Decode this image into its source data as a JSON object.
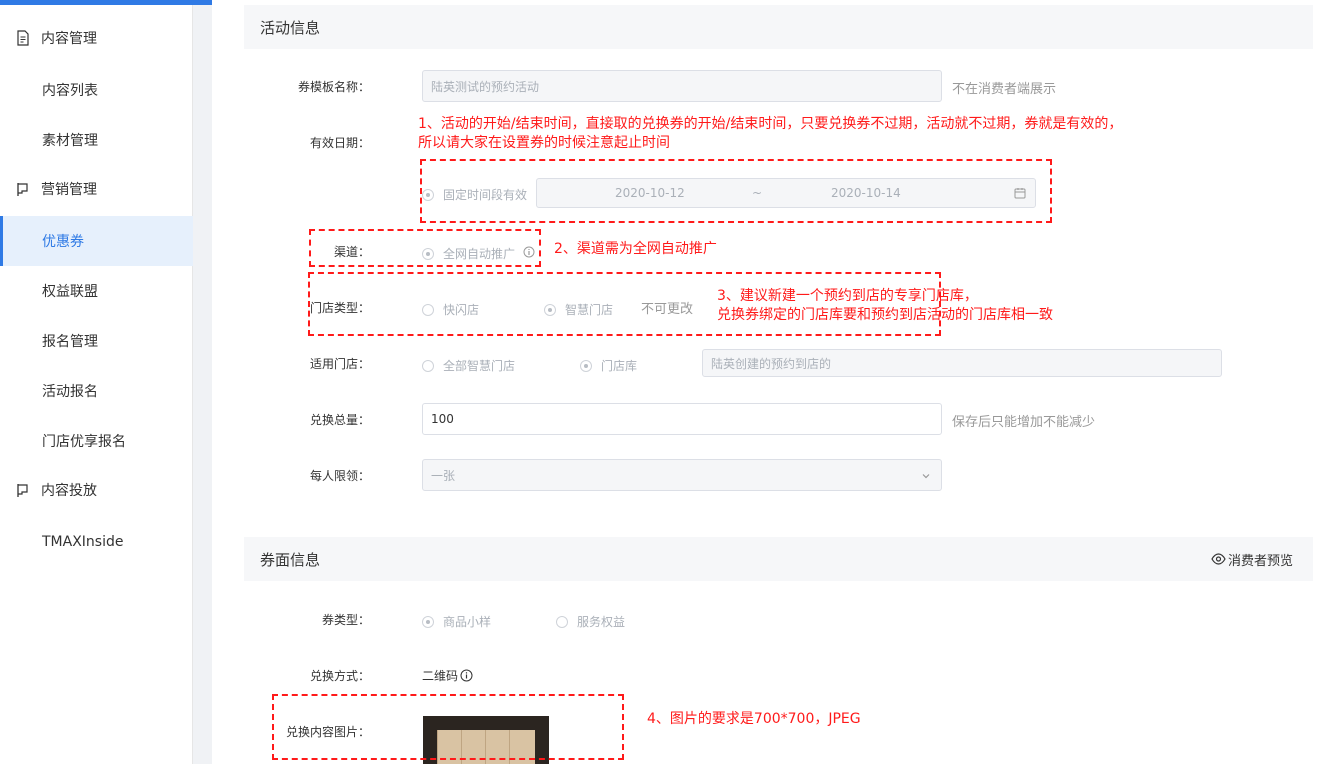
{
  "sidebar": {
    "items": [
      {
        "label": "内容管理",
        "type": "group",
        "icon": "document-icon"
      },
      {
        "label": "内容列表",
        "type": "sub"
      },
      {
        "label": "素材管理",
        "type": "sub"
      },
      {
        "label": "营销管理",
        "type": "group",
        "icon": "flag-icon"
      },
      {
        "label": "优惠券",
        "type": "sub",
        "active": true
      },
      {
        "label": "权益联盟",
        "type": "sub"
      },
      {
        "label": "报名管理",
        "type": "sub"
      },
      {
        "label": "活动报名",
        "type": "sub"
      },
      {
        "label": "门店优享报名",
        "type": "sub"
      },
      {
        "label": "内容投放",
        "type": "group",
        "icon": "flag-icon"
      },
      {
        "label": "TMAXInside",
        "type": "sub"
      }
    ]
  },
  "activity": {
    "section_title": "活动信息",
    "template_name": {
      "label": "券模板名称：",
      "value": "陆英测试的预约活动",
      "hint": "不在消费者端展示"
    },
    "validity": {
      "label": "有效日期：",
      "option": "固定时间段有效",
      "start": "2020-10-12",
      "separator": "~",
      "end": "2020-10-14"
    },
    "channel": {
      "label": "渠道：",
      "option": "全网自动推广"
    },
    "store_type": {
      "label": "门店类型：",
      "option1": "快闪店",
      "option2": "智慧门店",
      "hint": "不可更改"
    },
    "applicable_store": {
      "label": "适用门店：",
      "option1": "全部智慧门店",
      "option2": "门店库",
      "value": "陆英创建的预约到店的"
    },
    "total": {
      "label": "兑换总量：",
      "value": "100",
      "hint": "保存后只能增加不能减少"
    },
    "per_person": {
      "label": "每人限领：",
      "value": "一张"
    }
  },
  "coupon": {
    "section_title": "券面信息",
    "preview_label": "消费者预览",
    "type": {
      "label": "券类型：",
      "option1": "商品小样",
      "option2": "服务权益"
    },
    "redeem_method": {
      "label": "兑换方式：",
      "value": "二维码"
    },
    "image": {
      "label": "兑换内容图片："
    }
  },
  "annotations": {
    "a1_line1": "1、活动的开始/结束时间，直接取的兑换券的开始/结束时间，只要兑换券不过期，活动就不过期，券就是有效的，",
    "a1_line2": "所以请大家在设置券的时候注意起止时间",
    "a2": "2、渠道需为全网自动推广",
    "a3_line1": "3、建议新建一个预约到店的专享门店库，",
    "a3_line2": "兑换券绑定的门店库要和预约到店活动的门店库相一致",
    "a4": "4、图片的要求是700*700，JPEG"
  },
  "colors": {
    "accent": "#2f7ae5",
    "annotation": "#ff1a1a"
  }
}
